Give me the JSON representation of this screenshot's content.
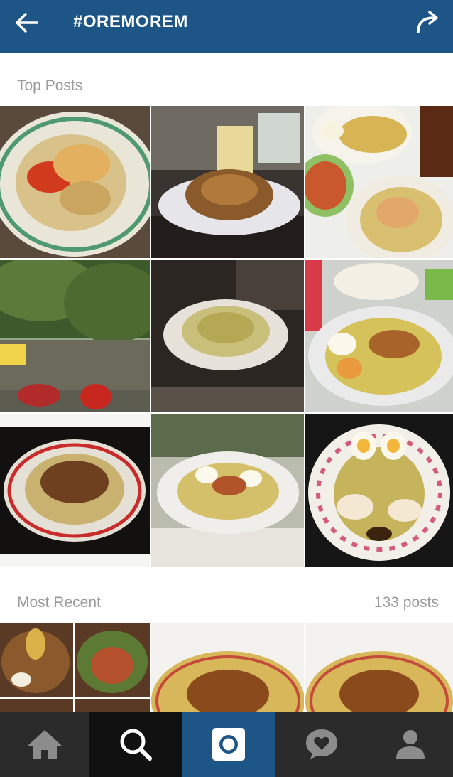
{
  "header": {
    "title": "#OREMOREM",
    "back_icon": "arrow-left-icon",
    "share_icon": "share-arrow-icon",
    "background": "#1d5686"
  },
  "top_posts": {
    "label": "Top Posts",
    "photos": [
      {
        "subject": "plate of oremorem with chili and crackers"
      },
      {
        "subject": "bowl of oremorem on table with drink"
      },
      {
        "subject": "plates of oremorem with boiled eggs and sauce"
      },
      {
        "subject": "oremorem stall with motorbikes"
      },
      {
        "subject": "hand holding bowl of oremorem"
      },
      {
        "subject": "bowl of oremorem with eggs"
      },
      {
        "subject": "oremorem plate with vignette"
      },
      {
        "subject": "bowl of oremorem with eggs on table"
      },
      {
        "subject": "floral plate of oremorem with two eggs"
      }
    ]
  },
  "most_recent": {
    "label": "Most Recent",
    "count_label": "133 posts",
    "photos": [
      {
        "subject": "collage of oremorem dishes"
      },
      {
        "subject": "bowl of oremorem close-up"
      },
      {
        "subject": "bowl of oremorem close-up"
      }
    ]
  },
  "bottom_nav": {
    "items": [
      {
        "name": "home",
        "icon": "home-icon"
      },
      {
        "name": "search",
        "icon": "search-icon",
        "active": true
      },
      {
        "name": "camera",
        "icon": "camera-icon"
      },
      {
        "name": "activity",
        "icon": "heart-bubble-icon"
      },
      {
        "name": "profile",
        "icon": "person-icon"
      }
    ],
    "accent": "#1d5686"
  }
}
